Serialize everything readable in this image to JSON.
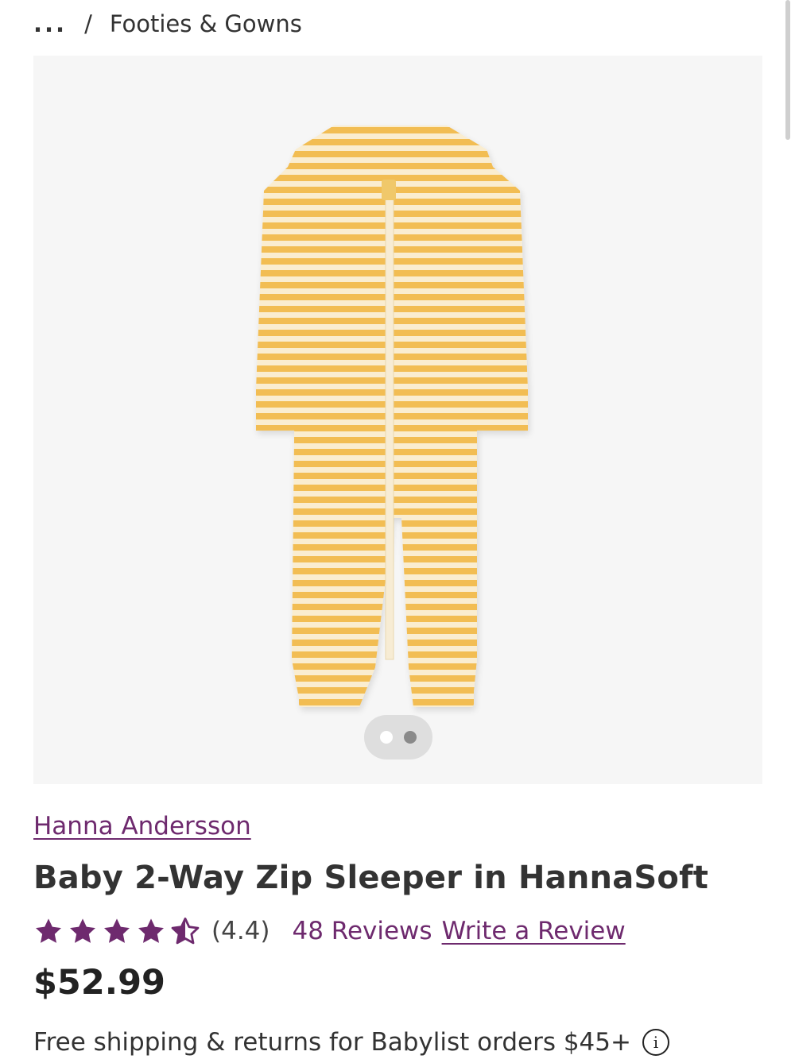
{
  "breadcrumb": {
    "ellipsis": "...",
    "separator": "/",
    "current": "Footies & Gowns"
  },
  "gallery": {
    "image_alt": "Yellow striped baby zip sleeper",
    "image_count": 2,
    "active_index": 0
  },
  "product": {
    "brand": "Hanna Andersson",
    "title": "Baby 2-Way Zip Sleeper in HannaSoft",
    "rating": 4.4,
    "rating_text": "(4.4)",
    "reviews_text": "48 Reviews",
    "write_review": "Write a Review",
    "price": "$52.99"
  },
  "shipping": {
    "text": "Free shipping & returns for Babylist orders $45+",
    "info_icon": "i"
  },
  "colors": {
    "brand_purple": "#6e2a6e",
    "stripe_yellow": "#f2bd52",
    "stripe_cream": "#faedd0"
  }
}
